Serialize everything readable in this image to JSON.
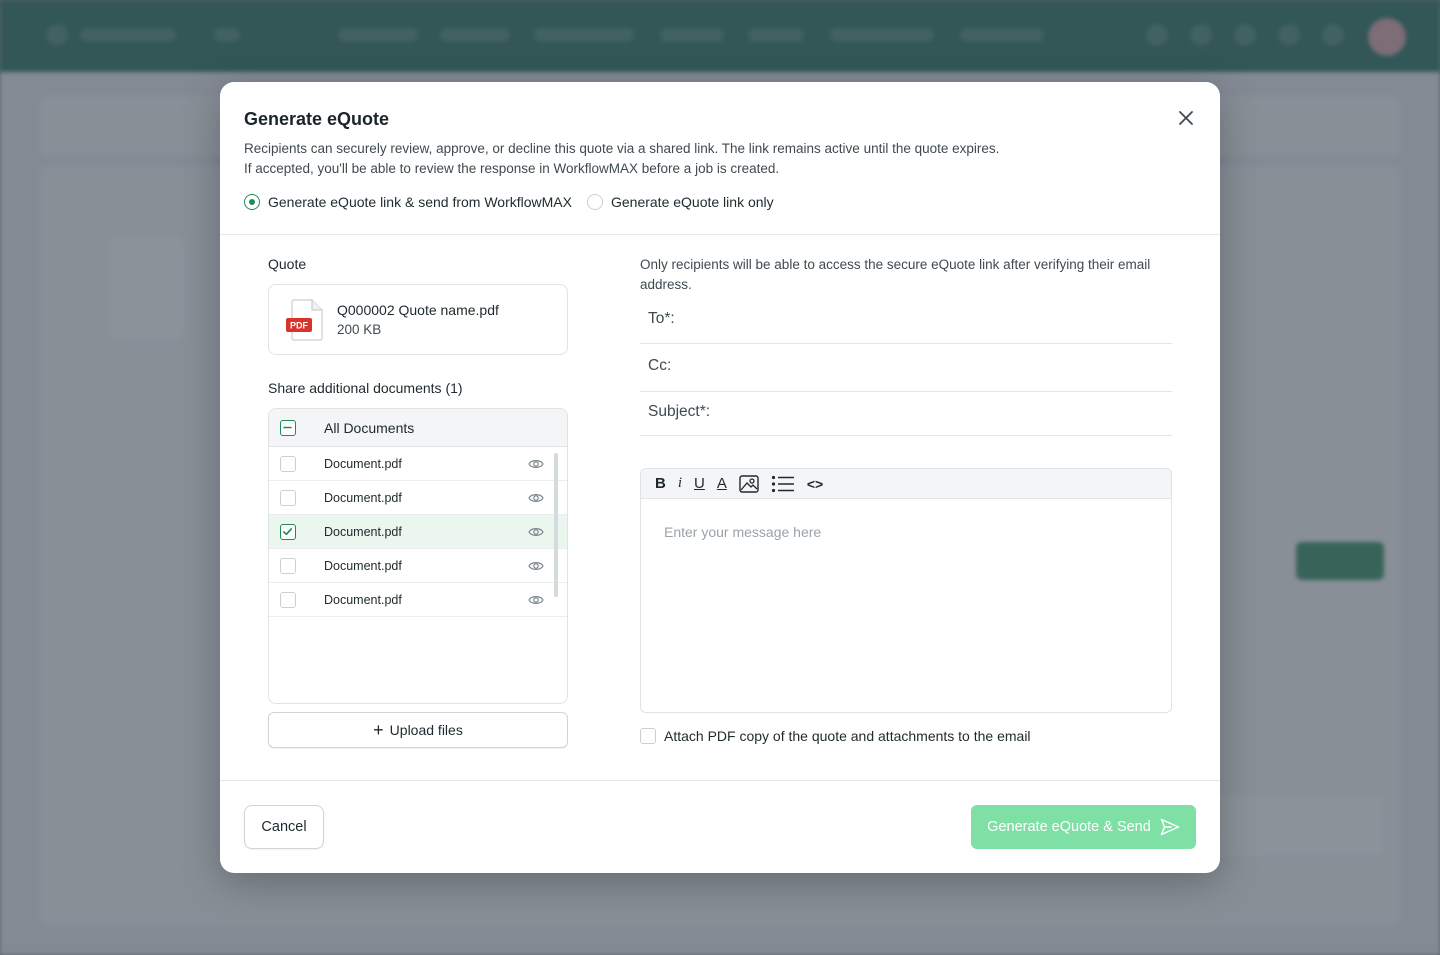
{
  "modal": {
    "title": "Generate eQuote",
    "description_line1": "Recipients can securely review, approve, or decline this quote via a shared link. The link remains active until the quote expires.",
    "description_line2": "If accepted, you'll be able to review the response in WorkflowMAX before a job is created.",
    "options": [
      {
        "label": "Generate eQuote link & send from WorkflowMAX",
        "selected": true
      },
      {
        "label": "Generate eQuote link only",
        "selected": false
      }
    ]
  },
  "quote": {
    "label": "Quote",
    "file_name": "Q000002 Quote name.pdf",
    "file_size": "200 KB",
    "icon_text": "PDF"
  },
  "documents": {
    "label": "Share additional documents (1)",
    "header": "All Documents",
    "items": [
      {
        "name": "Document.pdf",
        "checked": false
      },
      {
        "name": "Document.pdf",
        "checked": false
      },
      {
        "name": "Document.pdf",
        "checked": true
      },
      {
        "name": "Document.pdf",
        "checked": false
      },
      {
        "name": "Document.pdf",
        "checked": false
      }
    ],
    "upload_label": "Upload files"
  },
  "email": {
    "info": "Only recipients will be able to access the secure eQuote link after verifying their email address.",
    "to_label": "To*:",
    "cc_label": "Cc:",
    "subject_label": "Subject*:",
    "toolbar": [
      "B",
      "i",
      "U",
      "A",
      "image-icon",
      "list-icon",
      "<>"
    ],
    "placeholder": "Enter your message here",
    "attach_label": "Attach PDF copy of the quote and attachments to the email"
  },
  "footer": {
    "cancel_label": "Cancel",
    "send_label": "Generate eQuote & Send"
  },
  "colors": {
    "accent": "#1f8a54",
    "send_button": "#7fe0a6",
    "topbar": "#1e6b56",
    "pdf_red": "#d9342b"
  }
}
